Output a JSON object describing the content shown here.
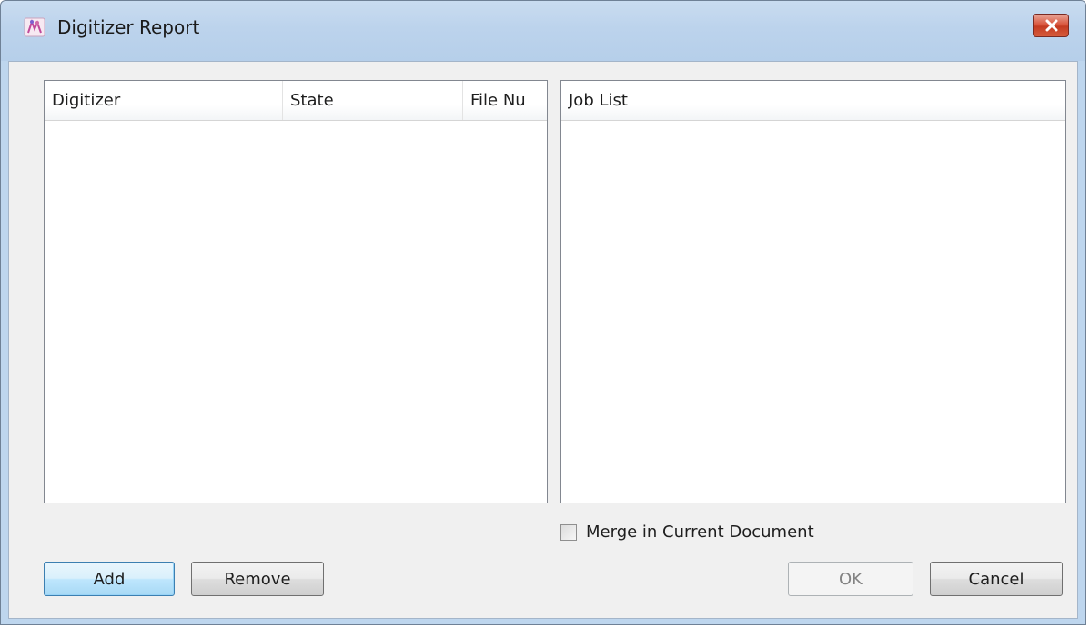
{
  "window": {
    "title": "Digitizer Report"
  },
  "digitizer_list": {
    "columns": [
      "Digitizer",
      "State",
      "File Nu"
    ],
    "rows": []
  },
  "job_list": {
    "columns": [
      "Job List"
    ],
    "rows": []
  },
  "merge_checkbox": {
    "label": "Merge in Current Document",
    "checked": false
  },
  "buttons": {
    "add": "Add",
    "remove": "Remove",
    "ok": "OK",
    "cancel": "Cancel"
  },
  "icons": {
    "app": "app-icon",
    "close": "close-icon"
  }
}
